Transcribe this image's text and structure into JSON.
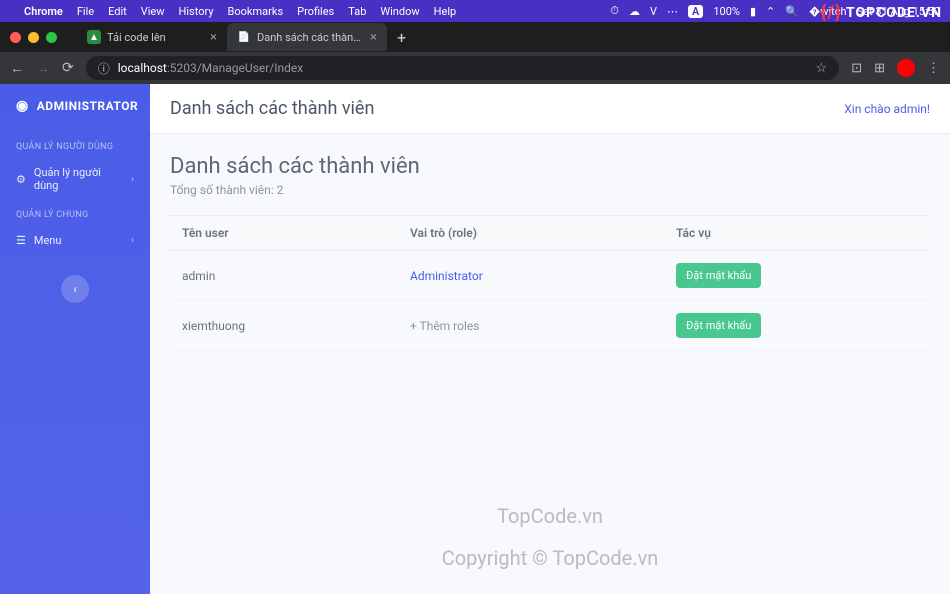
{
  "menubar": {
    "app": "Chrome",
    "items": [
      "File",
      "Edit",
      "View",
      "History",
      "Bookmarks",
      "Profiles",
      "Tab",
      "Window",
      "Help"
    ],
    "battery": "100%",
    "datetime": "Sat 31 Aug 15:50",
    "badge_v": "V",
    "badge_a": "A"
  },
  "tabs": [
    {
      "title": "Tải code lên",
      "active": false
    },
    {
      "title": "Danh sách các thành viên",
      "active": true
    }
  ],
  "url": {
    "host": "localhost",
    "path": ":5203/ManageUser/Index"
  },
  "sidebar": {
    "brand": "ADMINISTRATOR",
    "sections": [
      {
        "label": "QUẢN LÝ NGƯỜI DÙNG",
        "items": [
          {
            "icon": "gear",
            "label": "Quản lý người dùng"
          }
        ]
      },
      {
        "label": "QUẢN LÝ CHUNG",
        "items": [
          {
            "icon": "menu",
            "label": "Menu"
          }
        ]
      }
    ]
  },
  "header": {
    "title": "Danh sách các thành viên",
    "greeting": "Xin chào admin!"
  },
  "page": {
    "title": "Danh sách các thành viên",
    "subtitle": "Tổng số thành viên: 2"
  },
  "table": {
    "columns": [
      "Tên user",
      "Vai trò (role)",
      "Tác vụ"
    ],
    "rows": [
      {
        "username": "admin",
        "role": "Administrator",
        "role_type": "link",
        "action": "Đặt mật khẩu"
      },
      {
        "username": "xiemthuong",
        "role": "+ Thêm roles",
        "role_type": "add",
        "action": "Đặt mật khẩu"
      }
    ]
  },
  "watermarks": {
    "logo": "TOPCODE.VN",
    "center1": "TopCode.vn",
    "center2": "Copyright © TopCode.vn"
  }
}
